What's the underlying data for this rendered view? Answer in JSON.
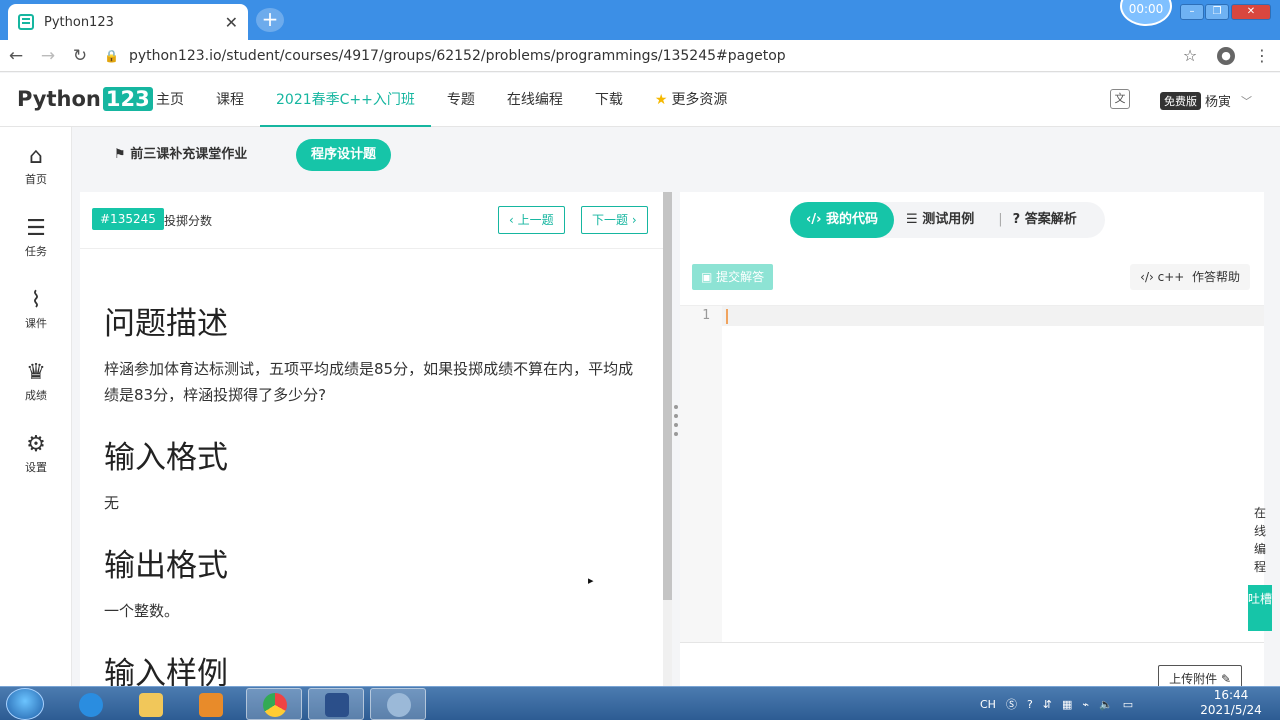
{
  "browser": {
    "tab_title": "Python123",
    "tab_close": "✕",
    "new_tab": "+",
    "clock_overlay": "00:00",
    "url": "python123.io/student/courses/4917/groups/62152/problems/programmings/135245#pagetop"
  },
  "site": {
    "logo_text": "Python",
    "logo_num": "123",
    "nav": [
      "主页",
      "课程",
      "2021春季C++入门班",
      "专题",
      "在线编程",
      "下载",
      "更多资源"
    ],
    "free_badge": "免费版",
    "username": "杨寅"
  },
  "rail": [
    "首页",
    "任务",
    "课件",
    "成绩",
    "设置"
  ],
  "subnav": {
    "homework": "前三课补充课堂作业",
    "design": "程序设计题"
  },
  "problem": {
    "id": "#135245",
    "title": "投掷分数",
    "prev": "上一题",
    "next": "下一题",
    "desc_title": "问题描述",
    "desc_text": "梓涵参加体育达标测试，五项平均成绩是85分，如果投掷成绩不算在内，平均成绩是83分，梓涵投掷得了多少分?",
    "input_title": "输入格式",
    "input_text": "无",
    "output_title": "输出格式",
    "output_text": "一个整数。",
    "sample_title": "输入样例"
  },
  "code": {
    "tab_mycode": "我的代码",
    "tab_tests": "测试用例",
    "tab_answer": "答案解析",
    "submit": "提交解答",
    "help_lang": "c++",
    "help_label": "作答帮助",
    "line1": "1",
    "upload": "上传附件"
  },
  "side": {
    "online_coding": "在线编程",
    "feedback": "吐槽"
  },
  "taskbar": {
    "lang": "CH",
    "time": "16:44",
    "date": "2021/5/24"
  }
}
